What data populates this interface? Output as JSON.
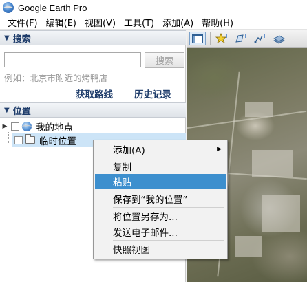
{
  "window": {
    "title": "Google Earth Pro"
  },
  "menubar": {
    "items": [
      "文件(F)",
      "编辑(E)",
      "视图(V)",
      "工具(T)",
      "添加(A)",
      "帮助(H)"
    ]
  },
  "search": {
    "header": "搜索",
    "input_value": "",
    "button_label": "搜索",
    "hint": "例如：北京市附近的烤鸭店",
    "get_directions": "获取路线",
    "history": "历史记录"
  },
  "places": {
    "header": "位置",
    "items": [
      {
        "label": "我的地点",
        "icon": "globe-icon",
        "checked": false
      },
      {
        "label": "临时位置",
        "icon": "folder-icon",
        "checked": false
      }
    ]
  },
  "map_toolbar": {
    "buttons": [
      "sidebar-toggle-icon",
      "placemark-icon",
      "polygon-icon",
      "path-icon",
      "overlay-icon"
    ]
  },
  "context_menu": {
    "items": [
      {
        "label": "添加(A)",
        "submenu": true,
        "highlighted": false
      },
      {
        "label": "复制",
        "submenu": false,
        "highlighted": false
      },
      {
        "label": "粘贴",
        "submenu": false,
        "highlighted": true
      },
      {
        "label": "保存到“我的位置”",
        "submenu": false,
        "highlighted": false
      },
      {
        "label": "将位置另存为...",
        "submenu": false,
        "highlighted": false
      },
      {
        "label": "发送电子邮件...",
        "submenu": false,
        "highlighted": false
      },
      {
        "label": "快照视图",
        "submenu": false,
        "highlighted": false
      }
    ]
  },
  "colors": {
    "header_text": "#1f3d6b",
    "selection": "#cce4f7",
    "menu_highlight": "#3d8fce"
  }
}
